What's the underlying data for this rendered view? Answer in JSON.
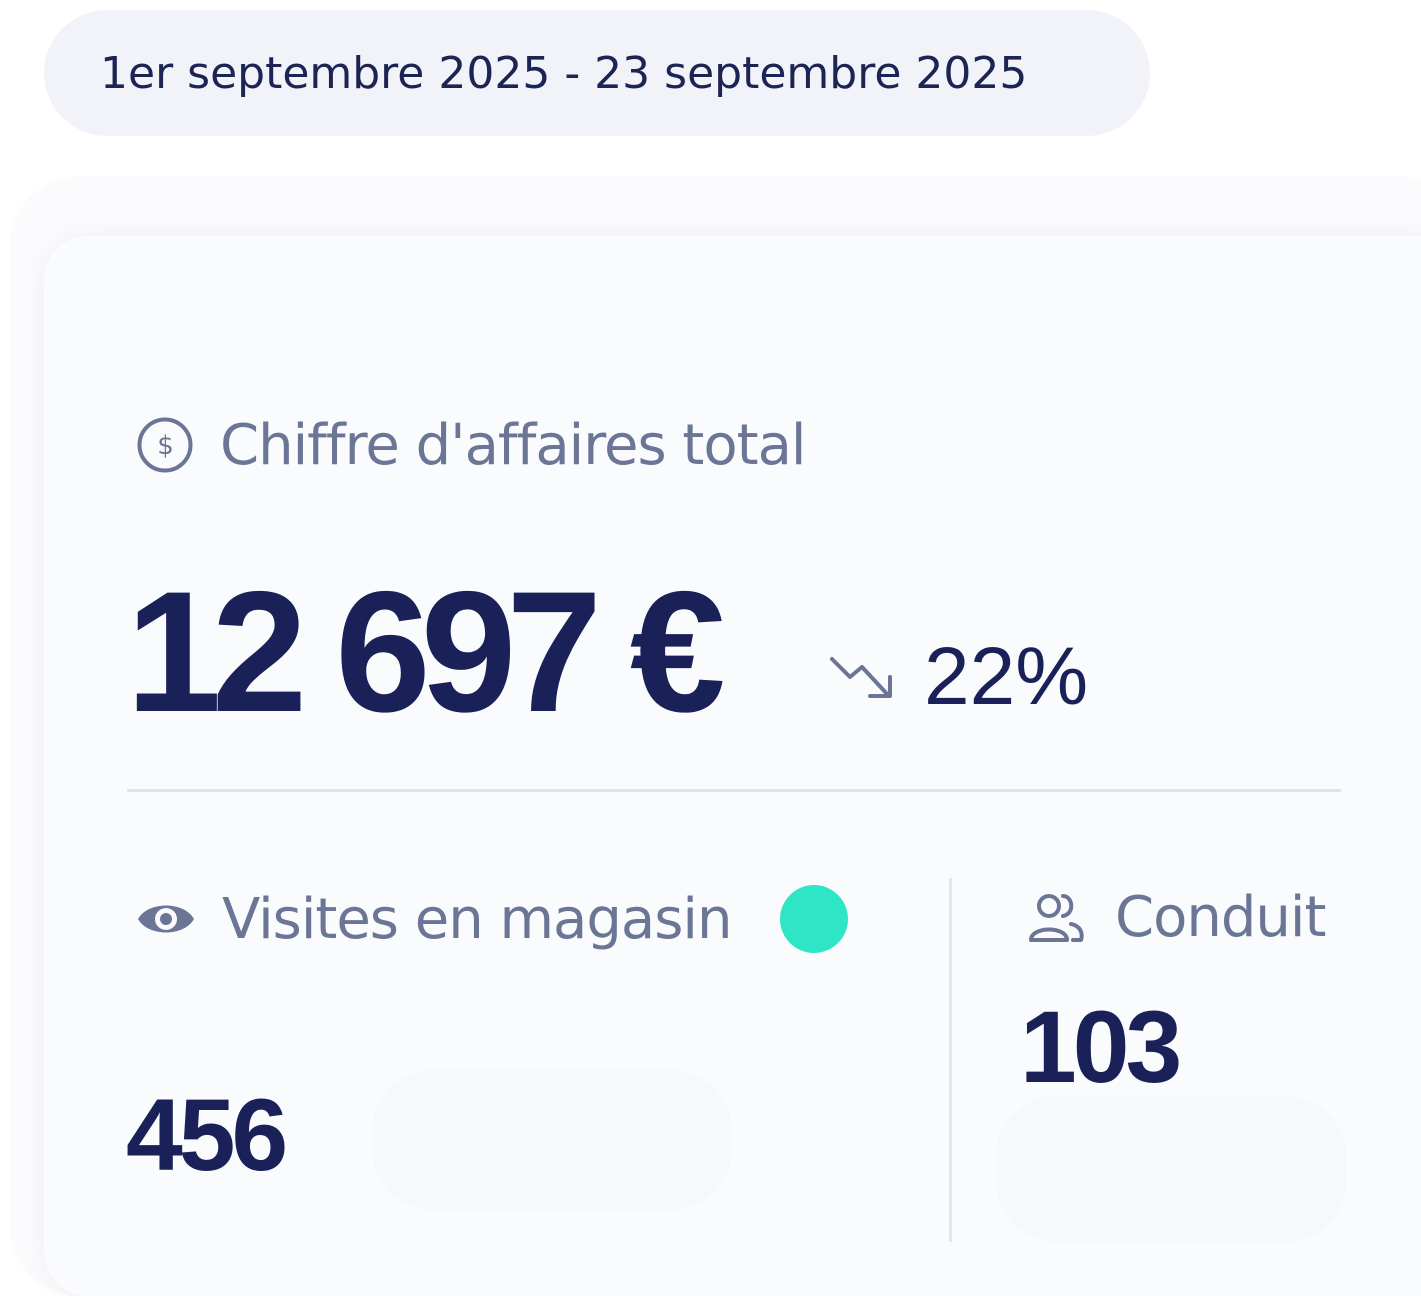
{
  "date_range": {
    "label": "1er septembre 2025 - 23 septembre 2025"
  },
  "revenue": {
    "label": "Chiffre d'affaires total",
    "icon": "dollar-circle-icon",
    "value": "12 697 €",
    "trend_icon": "trend-down-icon",
    "trend_value": "22%"
  },
  "visits": {
    "label": "Visites en magasin",
    "icon": "eye-icon",
    "status_color": "#2ee6c6",
    "value": "456"
  },
  "led": {
    "label": "Conduit",
    "icon": "users-icon",
    "value": "103"
  },
  "colors": {
    "primary": "#1a2158",
    "muted": "#6b7696",
    "accent": "#2ee6c6"
  }
}
